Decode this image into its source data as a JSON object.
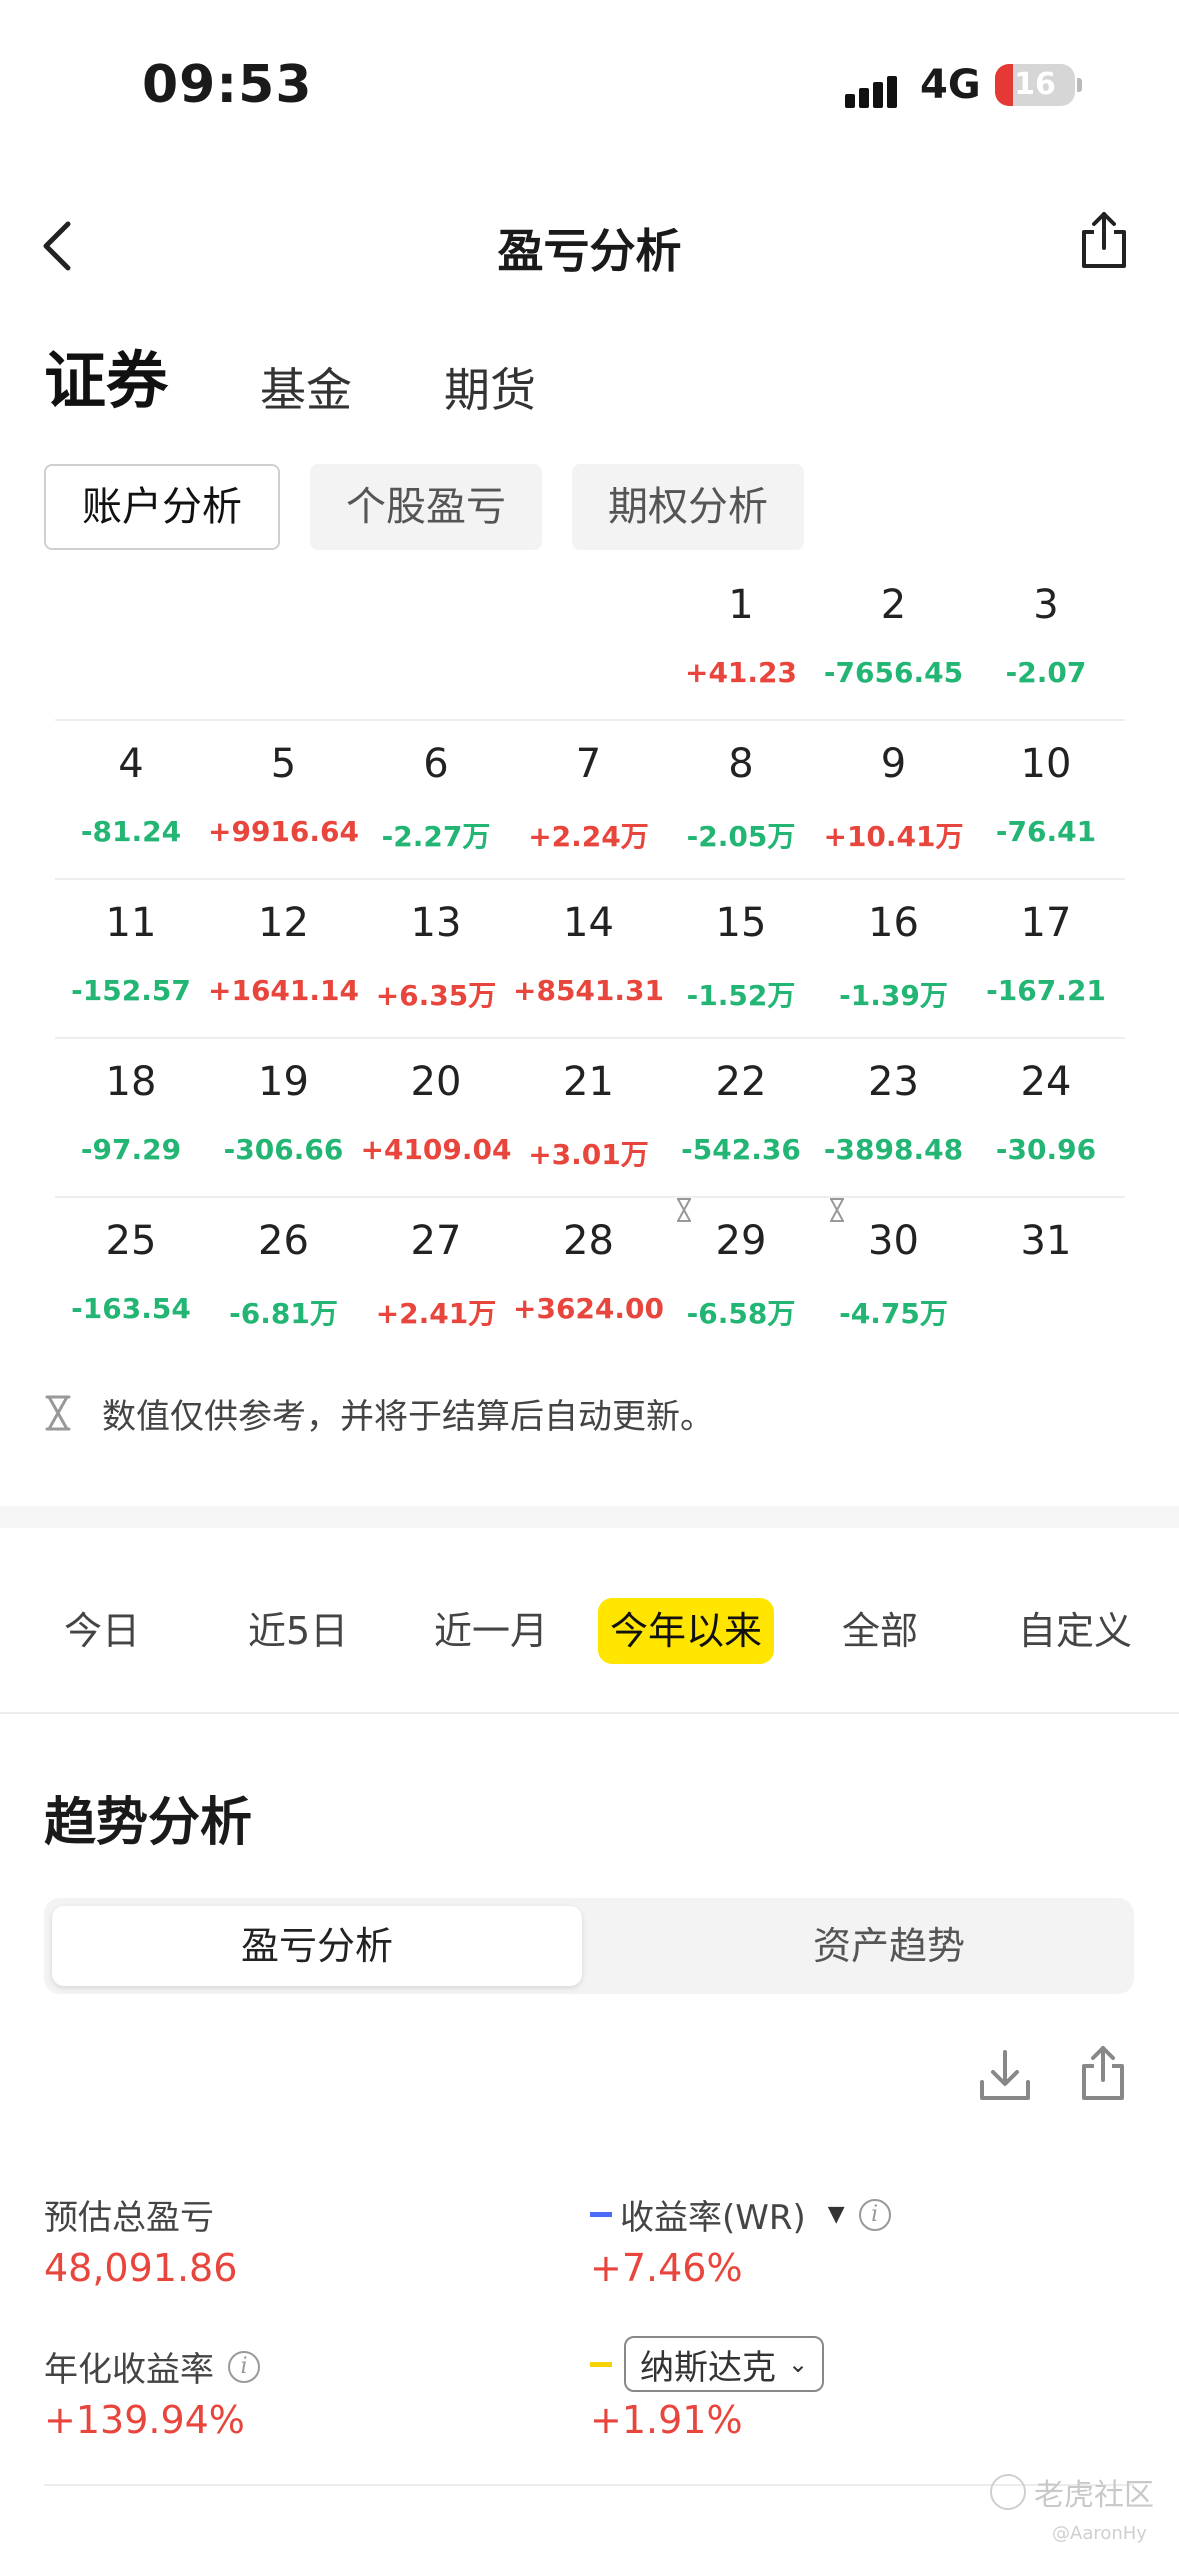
{
  "status_bar": {
    "time": "09:53",
    "network": "4G",
    "battery": "16"
  },
  "nav": {
    "title": "盈亏分析"
  },
  "market_tabs": [
    {
      "label": "证券",
      "active": true
    },
    {
      "label": "基金",
      "active": false
    },
    {
      "label": "期货",
      "active": false
    }
  ],
  "sub_tabs": [
    {
      "label": "账户分析",
      "active": true
    },
    {
      "label": "个股盈亏",
      "active": false
    },
    {
      "label": "期权分析",
      "active": false
    }
  ],
  "calendar": {
    "weeks": [
      [
        null,
        null,
        null,
        null,
        {
          "day": "1",
          "value": "+41.23",
          "sign": "pos"
        },
        {
          "day": "2",
          "value": "-7656.45",
          "sign": "neg"
        },
        {
          "day": "3",
          "value": "-2.07",
          "sign": "neg"
        }
      ],
      [
        {
          "day": "4",
          "value": "-81.24",
          "sign": "neg"
        },
        {
          "day": "5",
          "value": "+9916.64",
          "sign": "pos"
        },
        {
          "day": "6",
          "value": "-2.27万",
          "sign": "neg"
        },
        {
          "day": "7",
          "value": "+2.24万",
          "sign": "pos"
        },
        {
          "day": "8",
          "value": "-2.05万",
          "sign": "neg"
        },
        {
          "day": "9",
          "value": "+10.41万",
          "sign": "pos"
        },
        {
          "day": "10",
          "value": "-76.41",
          "sign": "neg"
        }
      ],
      [
        {
          "day": "11",
          "value": "-152.57",
          "sign": "neg"
        },
        {
          "day": "12",
          "value": "+1641.14",
          "sign": "pos"
        },
        {
          "day": "13",
          "value": "+6.35万",
          "sign": "pos"
        },
        {
          "day": "14",
          "value": "+8541.31",
          "sign": "pos"
        },
        {
          "day": "15",
          "value": "-1.52万",
          "sign": "neg"
        },
        {
          "day": "16",
          "value": "-1.39万",
          "sign": "neg"
        },
        {
          "day": "17",
          "value": "-167.21",
          "sign": "neg"
        }
      ],
      [
        {
          "day": "18",
          "value": "-97.29",
          "sign": "neg"
        },
        {
          "day": "19",
          "value": "-306.66",
          "sign": "neg"
        },
        {
          "day": "20",
          "value": "+4109.04",
          "sign": "pos"
        },
        {
          "day": "21",
          "value": "+3.01万",
          "sign": "pos"
        },
        {
          "day": "22",
          "value": "-542.36",
          "sign": "neg"
        },
        {
          "day": "23",
          "value": "-3898.48",
          "sign": "neg"
        },
        {
          "day": "24",
          "value": "-30.96",
          "sign": "neg"
        }
      ],
      [
        {
          "day": "25",
          "value": "-163.54",
          "sign": "neg"
        },
        {
          "day": "26",
          "value": "-6.81万",
          "sign": "neg"
        },
        {
          "day": "27",
          "value": "+2.41万",
          "sign": "pos"
        },
        {
          "day": "28",
          "value": "+3624.00",
          "sign": "pos"
        },
        {
          "day": "29",
          "value": "-6.58万",
          "sign": "neg",
          "pending": true
        },
        {
          "day": "30",
          "value": "-4.75万",
          "sign": "neg",
          "pending": true
        },
        {
          "day": "31",
          "value": "",
          "sign": "none"
        }
      ]
    ],
    "note": "数值仅供参考，并将于结算后自动更新。"
  },
  "period_tabs": [
    {
      "label": "今日",
      "active": false
    },
    {
      "label": "近5日",
      "active": false
    },
    {
      "label": "近一月",
      "active": false
    },
    {
      "label": "今年以来",
      "active": true
    },
    {
      "label": "全部",
      "active": false
    },
    {
      "label": "自定义",
      "active": false
    }
  ],
  "trend": {
    "title": "趋势分析",
    "segments": [
      "盈亏分析",
      "资产趋势"
    ],
    "stats": {
      "total_pnl_label": "预估总盈亏",
      "total_pnl_value": "48,091.86",
      "return_label": "收益率(WR)",
      "return_value": "+7.46%",
      "annual_label": "年化收益率",
      "annual_value": "+139.94%",
      "index_label": "纳斯达克",
      "index_value": "+1.91%"
    }
  },
  "colors": {
    "positive": "#e8453c",
    "negative": "#22b573",
    "accent_yellow": "#ffe500",
    "return_line": "#4a6cf7",
    "index_line": "#f5d300"
  },
  "watermark": {
    "brand": "老虎社区",
    "user": "@AaronHy"
  }
}
